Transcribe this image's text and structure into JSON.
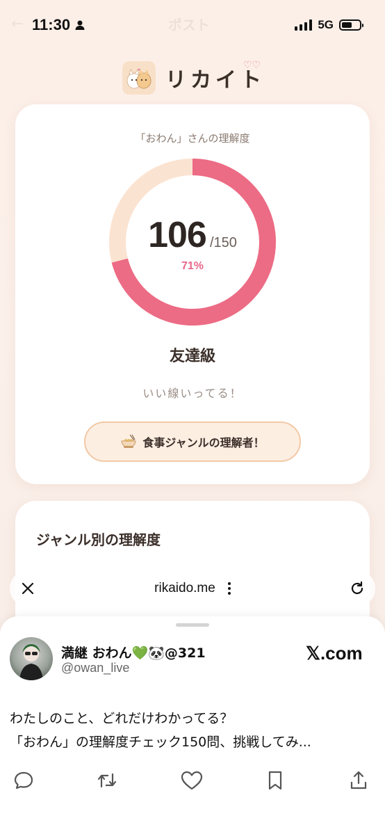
{
  "status_bar": {
    "time": "11:30",
    "network": "5G",
    "faded_title": "ポスト"
  },
  "app": {
    "name": "リカイト"
  },
  "result_card": {
    "subtitle": "「おわん」さんの理解度",
    "score": "106",
    "total": "/150",
    "percent": "71%",
    "progress_fraction": 0.71,
    "rank": "友達級",
    "comment": "いい線いってる！",
    "badge_label": "食事ジャンルの理解者！",
    "ring_color": "#ec6b85",
    "ring_track_color": "#fbe3d2"
  },
  "genre_card": {
    "title": "ジャンル別の理解度"
  },
  "browser": {
    "url": "rikaido.me"
  },
  "post": {
    "display_name": "満継 おわん💚🐼@321",
    "handle": "@owan_live",
    "source": "𝕏.com",
    "text_line1": "わたしのこと、どれだけわかってる？",
    "text_line2": "「おわん」の理解度チェック150問、挑戦してみ..."
  },
  "icons": [
    "person-icon",
    "signal-icon",
    "battery-icon",
    "app-logo-icon",
    "hearts-icon",
    "ramen-icon",
    "close-icon",
    "more-icon",
    "reload-icon",
    "reply-icon",
    "repost-icon",
    "like-icon",
    "bookmark-icon",
    "share-icon"
  ]
}
